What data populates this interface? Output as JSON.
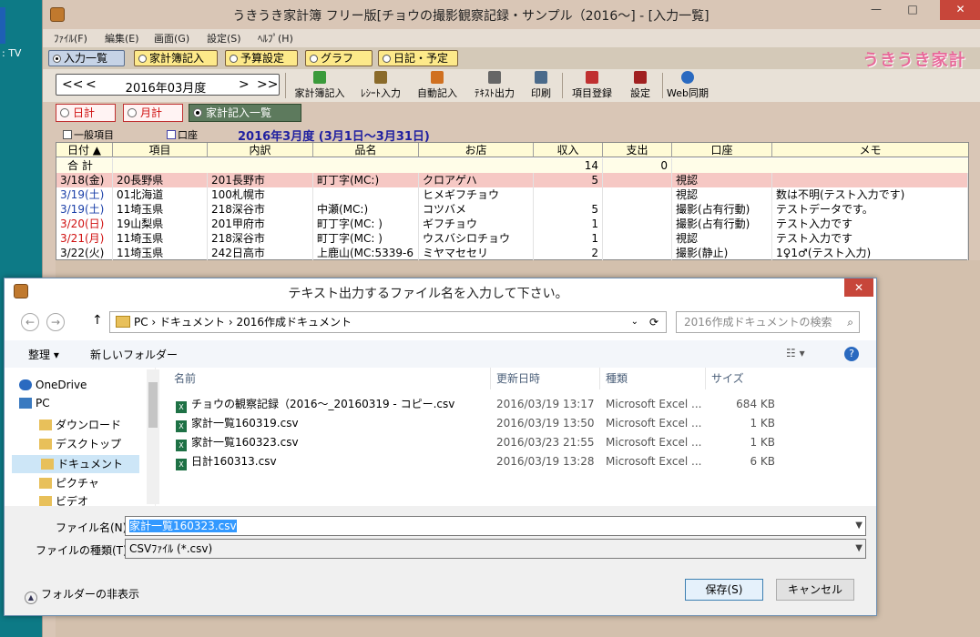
{
  "desktop": {
    "icon_label": ": TV"
  },
  "window": {
    "title": "うきうき家計簿 フリー版[チョウの撮影観察記録・サンプル（2016〜] - [入力一覧]",
    "min": "—",
    "max": "□",
    "close": "✕"
  },
  "menu": [
    "ﾌｧｲﾙ(F)",
    "編集(E)",
    "画面(G)",
    "設定(S)",
    "ﾍﾙﾌﾟ(H)"
  ],
  "tabs": [
    "入力一覧",
    "家計簿記入",
    "予算設定",
    "グラフ",
    "日記・予定"
  ],
  "brand": "うきうき家計簿",
  "date_nav": {
    "prev2": "<<",
    "prev": "<",
    "label": "2016年03月度",
    "next": ">",
    "next2": ">>"
  },
  "tools": [
    "家計簿記入",
    "ﾚｼｰﾄ入力",
    "自動記入",
    "ﾃｷｽﾄ出力",
    "印刷",
    "項目登録",
    "設定",
    "Web同期"
  ],
  "views": [
    "日計",
    "月計",
    "家計記入一覧"
  ],
  "filters": {
    "general": "一般項目",
    "account": "口座"
  },
  "period": "2016年3月度 (3月1日〜3月31日)",
  "grid": {
    "headers": [
      "日付 ▲",
      "項目",
      "内訳",
      "品名",
      "お店",
      "収入",
      "支出",
      "口座",
      "メモ"
    ],
    "total_label": "合 計",
    "total_income": "14",
    "total_expense": "0",
    "rows": [
      {
        "date": "3/18(金)",
        "item": "20長野県",
        "sub": "201長野市",
        "name": "町丁字(MC:)",
        "shop": "クロアゲハ",
        "income": "5",
        "expense": "",
        "account": "視認",
        "memo": ""
      },
      {
        "date": "3/19(土)",
        "item": "01北海道",
        "sub": "100札幌市",
        "name": "",
        "shop": "ヒメギフチョウ",
        "income": "",
        "expense": "",
        "account": "視認",
        "memo": "数は不明(テスト入力です)"
      },
      {
        "date": "3/19(土)",
        "item": "11埼玉県",
        "sub": "218深谷市",
        "name": "中瀬(MC:)",
        "shop": "コツバメ",
        "income": "5",
        "expense": "",
        "account": "撮影(占有行動)",
        "memo": "テストデータです。"
      },
      {
        "date": "3/20(日)",
        "item": "19山梨県",
        "sub": "201甲府市",
        "name": "町丁字(MC: )",
        "shop": "ギフチョウ",
        "income": "1",
        "expense": "",
        "account": "撮影(占有行動)",
        "memo": "テスト入力です"
      },
      {
        "date": "3/21(月)",
        "item": "11埼玉県",
        "sub": "218深谷市",
        "name": "町丁字(MC: )",
        "shop": "ウスバシロチョウ",
        "income": "1",
        "expense": "",
        "account": "視認",
        "memo": "テスト入力です"
      },
      {
        "date": "3/22(火)",
        "item": "11埼玉県",
        "sub": "242日高市",
        "name": "上鹿山(MC:5339-6",
        "shop": "ミヤマセセリ",
        "income": "2",
        "expense": "",
        "account": "撮影(静止)",
        "memo": "1♀1♂(テスト入力)"
      }
    ]
  },
  "dialog": {
    "title": "テキスト出力するファイル名を入力して下さい。",
    "close": "✕",
    "back": "←",
    "forward": "→",
    "up": "↑",
    "path": "PC  ›  ドキュメント  ›  2016作成ドキュメント",
    "search_placeholder": "2016作成ドキュメントの検索",
    "organize": "整理 ▾",
    "new_folder": "新しいフォルダー",
    "nav": [
      "OneDrive",
      "PC",
      "ダウンロード",
      "デスクトップ",
      "ドキュメント",
      "ピクチャ",
      "ビデオ"
    ],
    "columns": [
      "名前",
      "更新日時",
      "種類",
      "サイズ"
    ],
    "files": [
      {
        "name": "チョウの観察記録（2016〜_20160319 - コピー.csv",
        "date": "2016/03/19 13:17",
        "type": "Microsoft Excel ...",
        "size": "684 KB"
      },
      {
        "name": "家計一覧160319.csv",
        "date": "2016/03/19 13:50",
        "type": "Microsoft Excel ...",
        "size": "1 KB"
      },
      {
        "name": "家計一覧160323.csv",
        "date": "2016/03/23 21:55",
        "type": "Microsoft Excel ...",
        "size": "1 KB"
      },
      {
        "name": "日計160313.csv",
        "date": "2016/03/19 13:28",
        "type": "Microsoft Excel ...",
        "size": "6 KB"
      }
    ],
    "filename_label": "ファイル名(N):",
    "filename_value": "家計一覧160323.csv",
    "filetype_label": "ファイルの種類(T):",
    "filetype_value": "CSVﾌｧｲﾙ (*.csv)",
    "hide_folders": "フォルダーの非表示",
    "save": "保存(S)",
    "cancel": "キャンセル"
  },
  "colors": {
    "accent": "#3399ff",
    "row_highlight": "#f6c8c4",
    "sunday_red": "#d01010",
    "saturday_blue": "#1a3fa8"
  }
}
